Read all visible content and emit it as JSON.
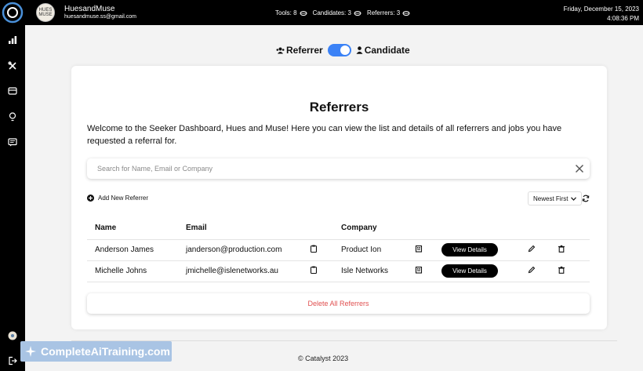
{
  "header": {
    "user_name": "HuesandMuse",
    "user_email": "huesandmuse.ss@gmail.com",
    "avatar_text": "HUES MUSE",
    "stats": [
      {
        "label": "Tools: 8"
      },
      {
        "label": "Candidates: 3"
      },
      {
        "label": "Referrers: 3"
      }
    ],
    "date": "Friday, December 15, 2023",
    "time": "4:08:36 PM"
  },
  "sidebar": {
    "items": [
      {
        "icon": "bar-chart-icon"
      },
      {
        "icon": "tools-icon"
      },
      {
        "icon": "card-icon"
      },
      {
        "icon": "lightbulb-icon"
      },
      {
        "icon": "message-icon"
      }
    ],
    "bottom": [
      {
        "icon": "avatar-small"
      },
      {
        "icon": "logout-icon"
      }
    ]
  },
  "mode_toggle": {
    "left_label": "Referrer",
    "right_label": "Candidate",
    "state": "on"
  },
  "main": {
    "title": "Referrers",
    "welcome": "Welcome to the Seeker Dashboard, Hues and Muse! Here you can view the list and details of all referrers and jobs you have requested a referral for.",
    "search_placeholder": "Search for Name, Email or Company",
    "add_label": "Add New Referrer",
    "sort_label": "Newest First",
    "columns": {
      "name": "Name",
      "email": "Email",
      "company": "Company"
    },
    "rows": [
      {
        "name": "Anderson James",
        "email": "janderson@production.com",
        "company": "Product Ion",
        "action": "View Details"
      },
      {
        "name": "Michelle Johns",
        "email": "jmichelle@islenetworks.au",
        "company": "Isle Networks",
        "action": "View Details"
      }
    ],
    "delete_all_label": "Delete All Referrers"
  },
  "footer": {
    "copyright": "© Catalyst 2023"
  },
  "watermark": {
    "text": "CompleteAiTraining.com"
  },
  "colors": {
    "accent": "#3b82f6",
    "danger": "#e05050",
    "chrome": "#000000"
  }
}
